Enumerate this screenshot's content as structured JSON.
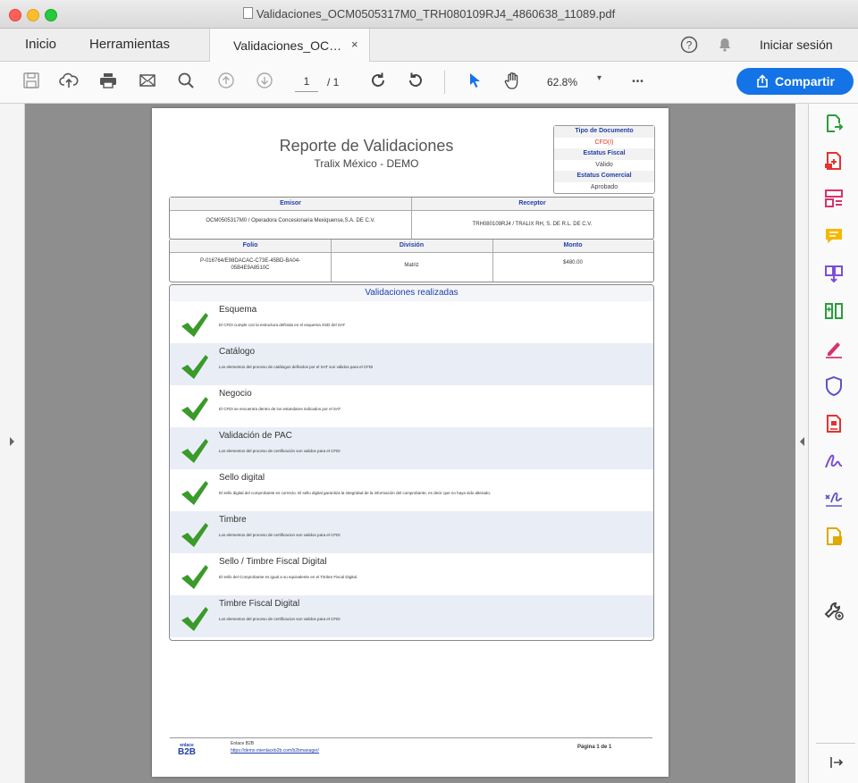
{
  "window": {
    "title": "Validaciones_OCM0505317M0_TRH080109RJ4_4860638_11089.pdf"
  },
  "tabs": {
    "home": "Inicio",
    "tools": "Herramientas",
    "document": "Validaciones_OC…",
    "close_glyph": "×",
    "sign_in": "Iniciar sesión",
    "help_glyph": "?"
  },
  "toolbar": {
    "page_current": "1",
    "page_total": "/ 1",
    "zoom": "62.8%",
    "zoom_caret": "▾",
    "more": "•••",
    "share_label": "Compartir"
  },
  "report": {
    "title": "Reporte de Validaciones",
    "subtitle": "Tralix México - DEMO",
    "tipo": {
      "label": "Tipo de Documento",
      "value": "CFD(I)",
      "fiscal_label": "Estatus Fiscal",
      "fiscal_value": "Válido",
      "comercial_label": "Estatus Comercial",
      "comercial_value": "Aprobado",
      "value_color": "#d9381e"
    },
    "emisor_label": "Emisor",
    "emisor_value": "OCM0505317M0 / Operadora Concesionaria Mexiquense,S.A. DE C.V.",
    "receptor_label": "Receptor",
    "receptor_value": "TRH080109RJ4 / TRALIX RH, S. DE R.L. DE C.V.",
    "folio_label": "Folio",
    "folio_value_line1": "P-016764/E98DACAC-C73E-45BD-BA04-",
    "folio_value_line2": "05B4E9A8510C",
    "division_label": "División",
    "division_value": "Matriz",
    "monto_label": "Monto",
    "monto_value": "$480.00",
    "validations_header": "Validaciones realizadas",
    "validations": [
      {
        "title": "Esquema",
        "desc": "El CFDI cumple con la estructura definida en el esquema XSD del SAT"
      },
      {
        "title": "Catálogo",
        "desc": "Los elementos del proceso de catálogos definidos por el SAT son válidos para el CFDI"
      },
      {
        "title": "Negocio",
        "desc": "El CFDI se encuentra dentro de los estandares indicados por el SAT"
      },
      {
        "title": "Validación de PAC",
        "desc": "Los elementos del proceso de certificación son validos para el CFDI"
      },
      {
        "title": "Sello digital",
        "desc": "El sello digital del comprobante es correcto. El sello digital garantiza la integridad de la información del comprobante, es decir que no haya sido alterado."
      },
      {
        "title": "Timbre",
        "desc": "Los elementos del proceso de certificacion son validos para el CFDI"
      },
      {
        "title": "Sello / Timbre Fiscal Digital",
        "desc": "El sello del Comprobante es igual a su equivalente en el Timbre Fiscal Digital."
      },
      {
        "title": "Timbre Fiscal Digital",
        "desc": "Los elementos del proceso de certificacion son validos para el CFDI"
      }
    ],
    "footer": {
      "logo_line1": "enlace",
      "logo_line2": "B2B",
      "enlace": "Enlace B2B",
      "url": "https://demo.mienlaceb2b.com/b2bmanager/",
      "page": "Página 1 de 1"
    }
  },
  "colors": {
    "accent": "#1473e6",
    "check": "#3a9a2a",
    "report_blue": "#2340a8",
    "cfdi_red": "#d9381e"
  },
  "icons": {
    "right_panel": [
      "export-pdf-icon",
      "create-pdf-icon",
      "edit-pdf-icon",
      "comment-icon",
      "combine-files-icon",
      "organize-pages-icon",
      "fill-sign-icon",
      "protect-icon",
      "compress-pdf-icon",
      "request-signature-icon",
      "fill-sign-pen-icon",
      "send-for-review-icon",
      "more-tools-icon"
    ]
  }
}
